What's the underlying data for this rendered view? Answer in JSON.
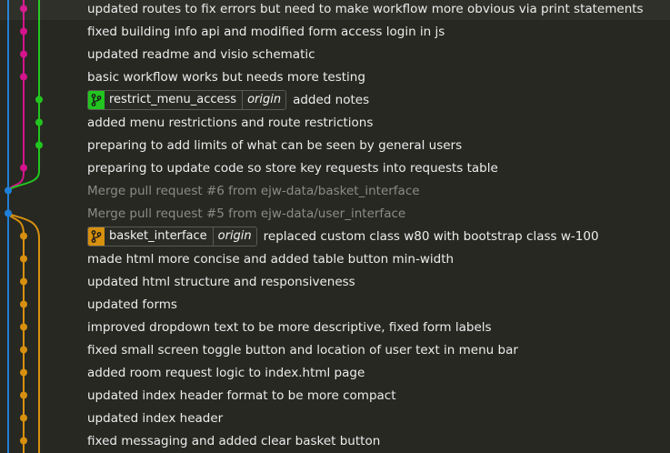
{
  "colors": {
    "background": "#272822",
    "lane_blue": "#1f7fd6",
    "lane_magenta": "#d4148c",
    "lane_green": "#22c51f",
    "lane_orange": "#d7900e",
    "tag_green": "#22c51f",
    "tag_orange": "#d7900e"
  },
  "commits": [
    {
      "message": "updated routes to fix errors but need to make workflow more obvious via print statements",
      "lane": "magenta"
    },
    {
      "message": "fixed building info api and modified form access login in js",
      "lane": "magenta"
    },
    {
      "message": "updated readme and visio schematic",
      "lane": "magenta"
    },
    {
      "message": "basic workflow works but needs more testing",
      "lane": "magenta"
    },
    {
      "message": "added notes",
      "lane": "green",
      "tag": {
        "branch": "restrict_menu_access",
        "remote": "origin",
        "color": "#22c51f",
        "icon": "git-branch-icon"
      }
    },
    {
      "message": "added menu restrictions and route restrictions",
      "lane": "green"
    },
    {
      "message": "preparing to add limits of what can be seen by general users",
      "lane": "green"
    },
    {
      "message": "preparing to update code so store key requests into requests table",
      "lane": "magenta"
    },
    {
      "message": "Merge pull request #6 from ejw-data/basket_interface",
      "lane": "blue",
      "dimmed": true
    },
    {
      "message": "Merge pull request #5 from ejw-data/user_interface",
      "lane": "blue",
      "dimmed": true
    },
    {
      "message": "replaced custom class w80 with bootstrap class w-100",
      "lane": "orange",
      "tag": {
        "branch": "basket_interface",
        "remote": "origin",
        "color": "#d7900e",
        "icon": "git-branch-icon"
      }
    },
    {
      "message": "made html more concise and added table button min-width",
      "lane": "orange"
    },
    {
      "message": "updated html structure and responsiveness",
      "lane": "orange"
    },
    {
      "message": "updated forms",
      "lane": "orange"
    },
    {
      "message": "improved dropdown text to be more descriptive, fixed form labels",
      "lane": "orange"
    },
    {
      "message": "fixed small screen toggle button and location of user text in menu bar",
      "lane": "orange"
    },
    {
      "message": "added room request logic to index.html page",
      "lane": "orange"
    },
    {
      "message": "updated index header format to be more compact",
      "lane": "orange"
    },
    {
      "message": "updated index header",
      "lane": "orange"
    },
    {
      "message": "fixed messaging and added clear basket button",
      "lane": "orange"
    }
  ]
}
